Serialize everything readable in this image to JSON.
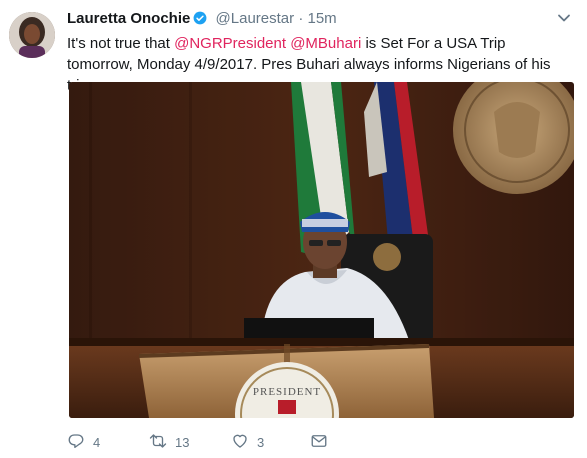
{
  "author": {
    "name": "Lauretta Onochie",
    "handle": "@Laurestar",
    "separator": "·",
    "time": "15m"
  },
  "tweet": {
    "text_before": "It's not true that ",
    "mention1": "@NGRPresident",
    "space": " ",
    "mention2": "@MBuhari",
    "text_after": " is Set For a USA Trip tomorrow, Monday 4/9/2017. Pres Buhari always informs Nigerians of his trips"
  },
  "actions": {
    "replies": "4",
    "retweets": "13",
    "likes": "3"
  },
  "colors": {
    "mention": "#e0245e",
    "verified": "#1da1f2",
    "muted": "#657786"
  },
  "icons": [
    "verified-badge-icon",
    "chevron-down-icon",
    "reply-icon",
    "retweet-icon",
    "like-icon",
    "message-icon"
  ]
}
